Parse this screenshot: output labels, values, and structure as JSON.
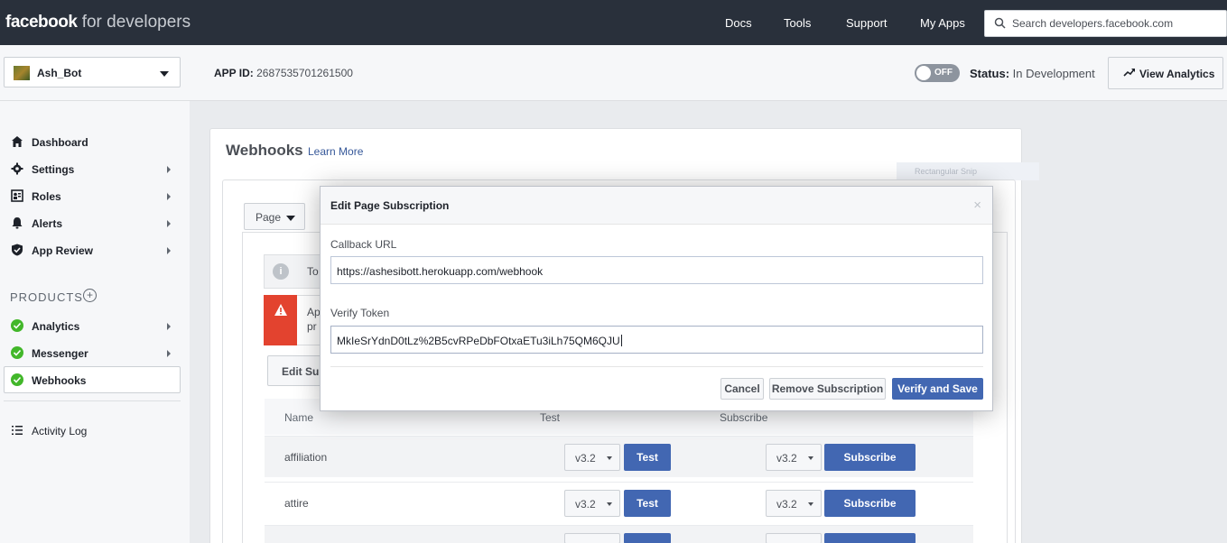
{
  "topbar": {
    "brand_bold": "facebook",
    "brand_light": " for developers",
    "nav": [
      "Docs",
      "Tools",
      "Support",
      "My Apps"
    ],
    "search_placeholder": "Search developers.facebook.com"
  },
  "appbar": {
    "app_name": "Ash_Bot",
    "app_id_label": "APP ID:",
    "app_id_value": " 2687535701261500",
    "toggle_label": "OFF",
    "status_label": "Status:",
    "status_value": " In Development",
    "analytics_button": "View Analytics"
  },
  "sidebar": {
    "items": [
      {
        "label": "Dashboard"
      },
      {
        "label": "Settings"
      },
      {
        "label": "Roles"
      },
      {
        "label": "Alerts"
      },
      {
        "label": "App Review"
      }
    ],
    "products_heading": "PRODUCTS",
    "products_add": "+",
    "products": [
      {
        "label": "Analytics"
      },
      {
        "label": "Messenger"
      },
      {
        "label": "Webhooks"
      }
    ],
    "activity_log": "Activity Log"
  },
  "main": {
    "title": "Webhooks",
    "learn_more": "Learn More",
    "page_select": "Page",
    "info_text": "To",
    "warn_line1": "Ap",
    "warn_line2": "pr",
    "edit_subscription_button": "Edit Sub",
    "table": {
      "headers": [
        "Name",
        "Test",
        "Subscribe"
      ],
      "rows": [
        {
          "name": "affiliation",
          "test_version": "v3.2",
          "test_label": "Test",
          "sub_version": "v3.2",
          "sub_label": "Subscribe"
        },
        {
          "name": "attire",
          "test_version": "v3.2",
          "test_label": "Test",
          "sub_version": "v3.2",
          "sub_label": "Subscribe"
        }
      ]
    },
    "snip_label": "Rectangular Snip"
  },
  "modal": {
    "title": "Edit Page Subscription",
    "close": "×",
    "callback_label": "Callback URL",
    "callback_value": "https://ashesibott.herokuapp.com/webhook",
    "verify_label": "Verify Token",
    "verify_value": "MkIeSrYdnD0tLz%2B5cvRPeDbFOtxaETu3iLh75QM6QJU",
    "cancel": "Cancel",
    "remove": "Remove Subscription",
    "verify_save": "Verify and Save"
  },
  "colors": {
    "topbar": "#29303b",
    "primary": "#4267b2",
    "success": "#42b72a",
    "danger": "#e3432f"
  }
}
